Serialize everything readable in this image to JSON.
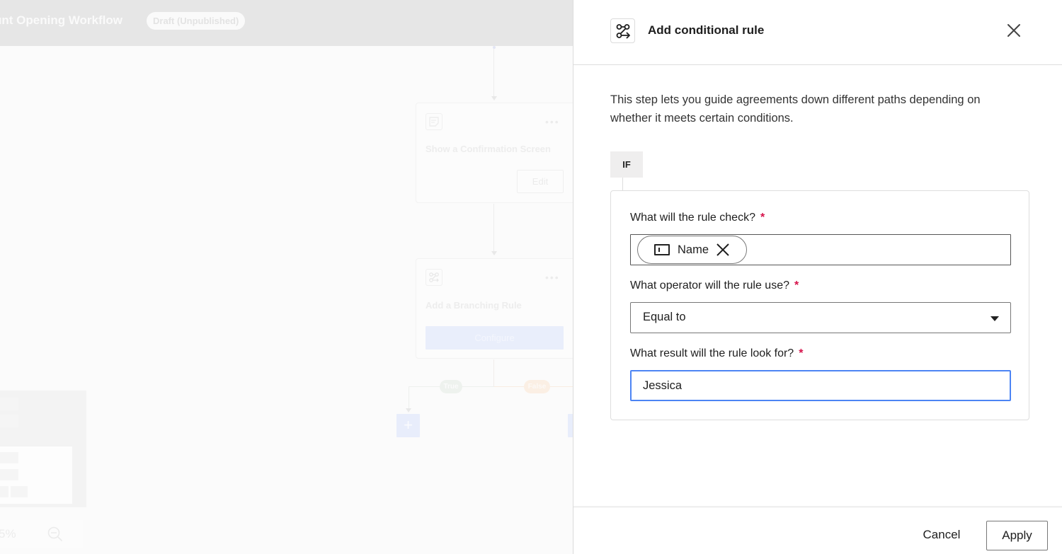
{
  "background": {
    "workflow_title": "unt Opening Workflow",
    "status_badge": "Draft (Unpublished)",
    "steps": [
      {
        "icon": "note-icon",
        "title": "Show a Confirmation Screen",
        "action_label": "Edit"
      },
      {
        "icon": "branch-icon",
        "title": "Add a Branching Rule",
        "action_label": "Configure"
      }
    ],
    "branches": {
      "true_label": "True",
      "false_label": "False"
    },
    "add_step_label": "+",
    "zoom_level": "5%"
  },
  "panel": {
    "title": "Add conditional rule",
    "icon": "conditional-branch-icon",
    "description": "This step lets you guide agreements down different paths depending on whether it meets certain conditions.",
    "if_label": "IF",
    "fields": {
      "check": {
        "label": "What will the rule check?",
        "required_mark": "*",
        "chip_label": "Name",
        "chip_icon": "text-field-icon"
      },
      "operator": {
        "label": "What operator will the rule use?",
        "required_mark": "*",
        "selected_value": "Equal to"
      },
      "result": {
        "label": "What result will the rule look for?",
        "required_mark": "*",
        "value": "Jessica"
      }
    },
    "footer": {
      "cancel_label": "Cancel",
      "apply_label": "Apply"
    }
  },
  "colors": {
    "required": "#d6124a",
    "focus_border": "#4c84f4"
  }
}
